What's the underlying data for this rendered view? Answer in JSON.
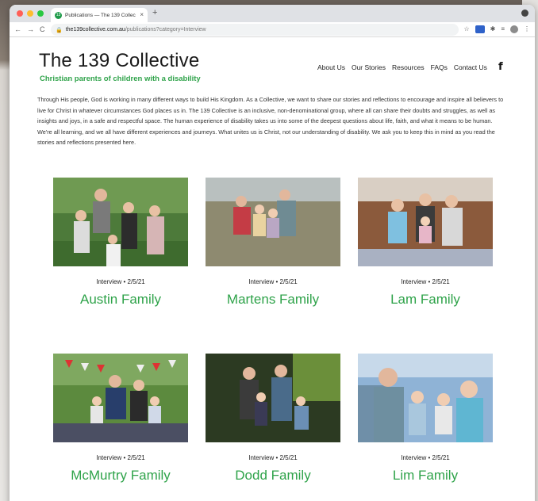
{
  "browser": {
    "tab_title": "Publications — The 139 Collec",
    "favicon_text": "13",
    "url_host": "the139collective.com.au",
    "url_path": "/publications?category=Interview",
    "new_tab": "+",
    "tab_close": "×"
  },
  "site": {
    "title": "The 139 Collective",
    "tagline": "Christian parents of children with a disability",
    "nav": [
      "About Us",
      "Our Stories",
      "Resources",
      "FAQs",
      "Contact Us"
    ],
    "intro": "Through His people, God is working in many different ways to build His Kingdom. As a Collective, we want to share our stories and reflections to encourage and inspire all believers to live for Christ in whatever circumstances God places us in. The 139 Collective is an inclusive, non-denominational group, where all can share their doubts and struggles, as well as insights and joys, in a safe and respectful space. The human experience of disability takes us into some of the deepest questions about life, faith, and what it means to be human. We're all learning, and we all have different experiences and journeys. What unites us is Christ, not our understanding of disability. We ask you to keep this in mind as you read the stories and reflections presented here."
  },
  "cards": [
    {
      "meta": "Interview • 2/5/21",
      "name": "Austin Family"
    },
    {
      "meta": "Interview • 2/5/21",
      "name": "Martens Family"
    },
    {
      "meta": "Interview • 2/5/21",
      "name": "Lam Family"
    },
    {
      "meta": "Interview • 2/5/21",
      "name": "McMurtry Family"
    },
    {
      "meta": "Interview • 2/5/21",
      "name": "Dodd Family"
    },
    {
      "meta": "Interview • 2/5/21",
      "name": "Lim Family"
    }
  ],
  "colors": {
    "accent_green": "#2fa34a",
    "chrome_tabstrip": "#dfe1e5"
  },
  "icons": {
    "facebook": "facebook-icon",
    "back": "arrow-left-icon",
    "forward": "arrow-right-icon",
    "reload": "reload-icon",
    "lock": "lock-icon",
    "star": "star-icon"
  }
}
